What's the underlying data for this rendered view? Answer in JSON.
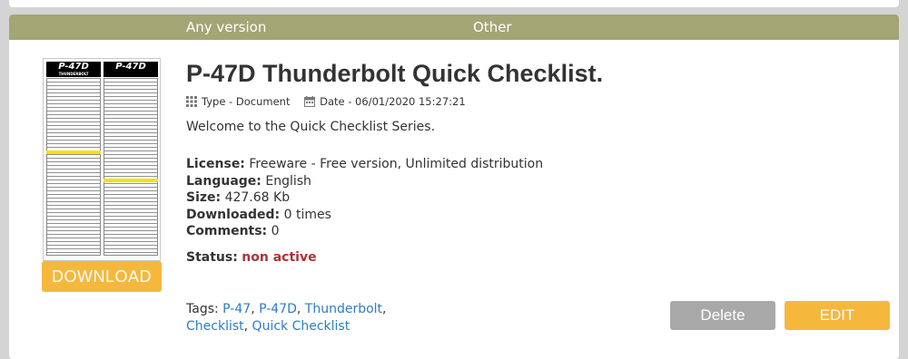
{
  "header": {
    "version_label": "Any version",
    "category_label": "Other"
  },
  "thumbnail": {
    "left_title": "P-47D",
    "left_subtitle": "THUNDERBOLT",
    "right_title": "P-47D"
  },
  "download_label": "DOWNLOAD",
  "title": "P-47D Thunderbolt Quick Checklist.",
  "meta": {
    "type": "Type - Document",
    "date": "Date - 06/01/2020 15:27:21",
    "type_icon": "grid-icon",
    "date_icon": "calendar-icon"
  },
  "description": "Welcome to the Quick Checklist Series.",
  "info": {
    "license_label": "License:",
    "license_value": "Freeware - Free version, Unlimited distribution",
    "language_label": "Language:",
    "language_value": "English",
    "size_label": "Size:",
    "size_value": "427.68 Kb",
    "downloaded_label": "Downloaded:",
    "downloaded_value": "0 times",
    "comments_label": "Comments:",
    "comments_value": "0"
  },
  "status": {
    "label": "Status:",
    "value": "non active"
  },
  "tags": {
    "label": "Tags:",
    "items": [
      "P-47",
      "P-47D",
      "Thunderbolt",
      "Checklist",
      "Quick Checklist"
    ]
  },
  "actions": {
    "delete_label": "Delete",
    "edit_label": "EDIT"
  },
  "colors": {
    "header": "#a3a574",
    "accent": "#f5b83d",
    "link": "#2e7bc4",
    "status": "#aa3333"
  }
}
